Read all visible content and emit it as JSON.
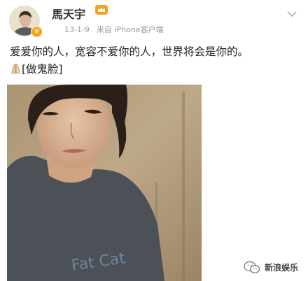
{
  "post": {
    "author": {
      "name": "馬天宇",
      "verified": true,
      "verified_color": "#f5a623",
      "member_badge_icon": "vip-crown-icon"
    },
    "meta": {
      "date": "13-1-9",
      "source": "来自 iPhone客户端"
    },
    "text_line1": "爱爱你的人，宽容不爱你的人，世界将会是你的。",
    "text_line2_emoji": "[做鬼脸]",
    "photo": {
      "description_icon": "selfie-photo",
      "shirt_print": "Fat Cat"
    },
    "menu_icon": "chevron-down-icon"
  },
  "watermark": {
    "icon": "wechat-icon",
    "text": "新浪娱乐"
  },
  "colors": {
    "text": "#222222",
    "meta": "#999999",
    "badge": "#f5a623"
  }
}
